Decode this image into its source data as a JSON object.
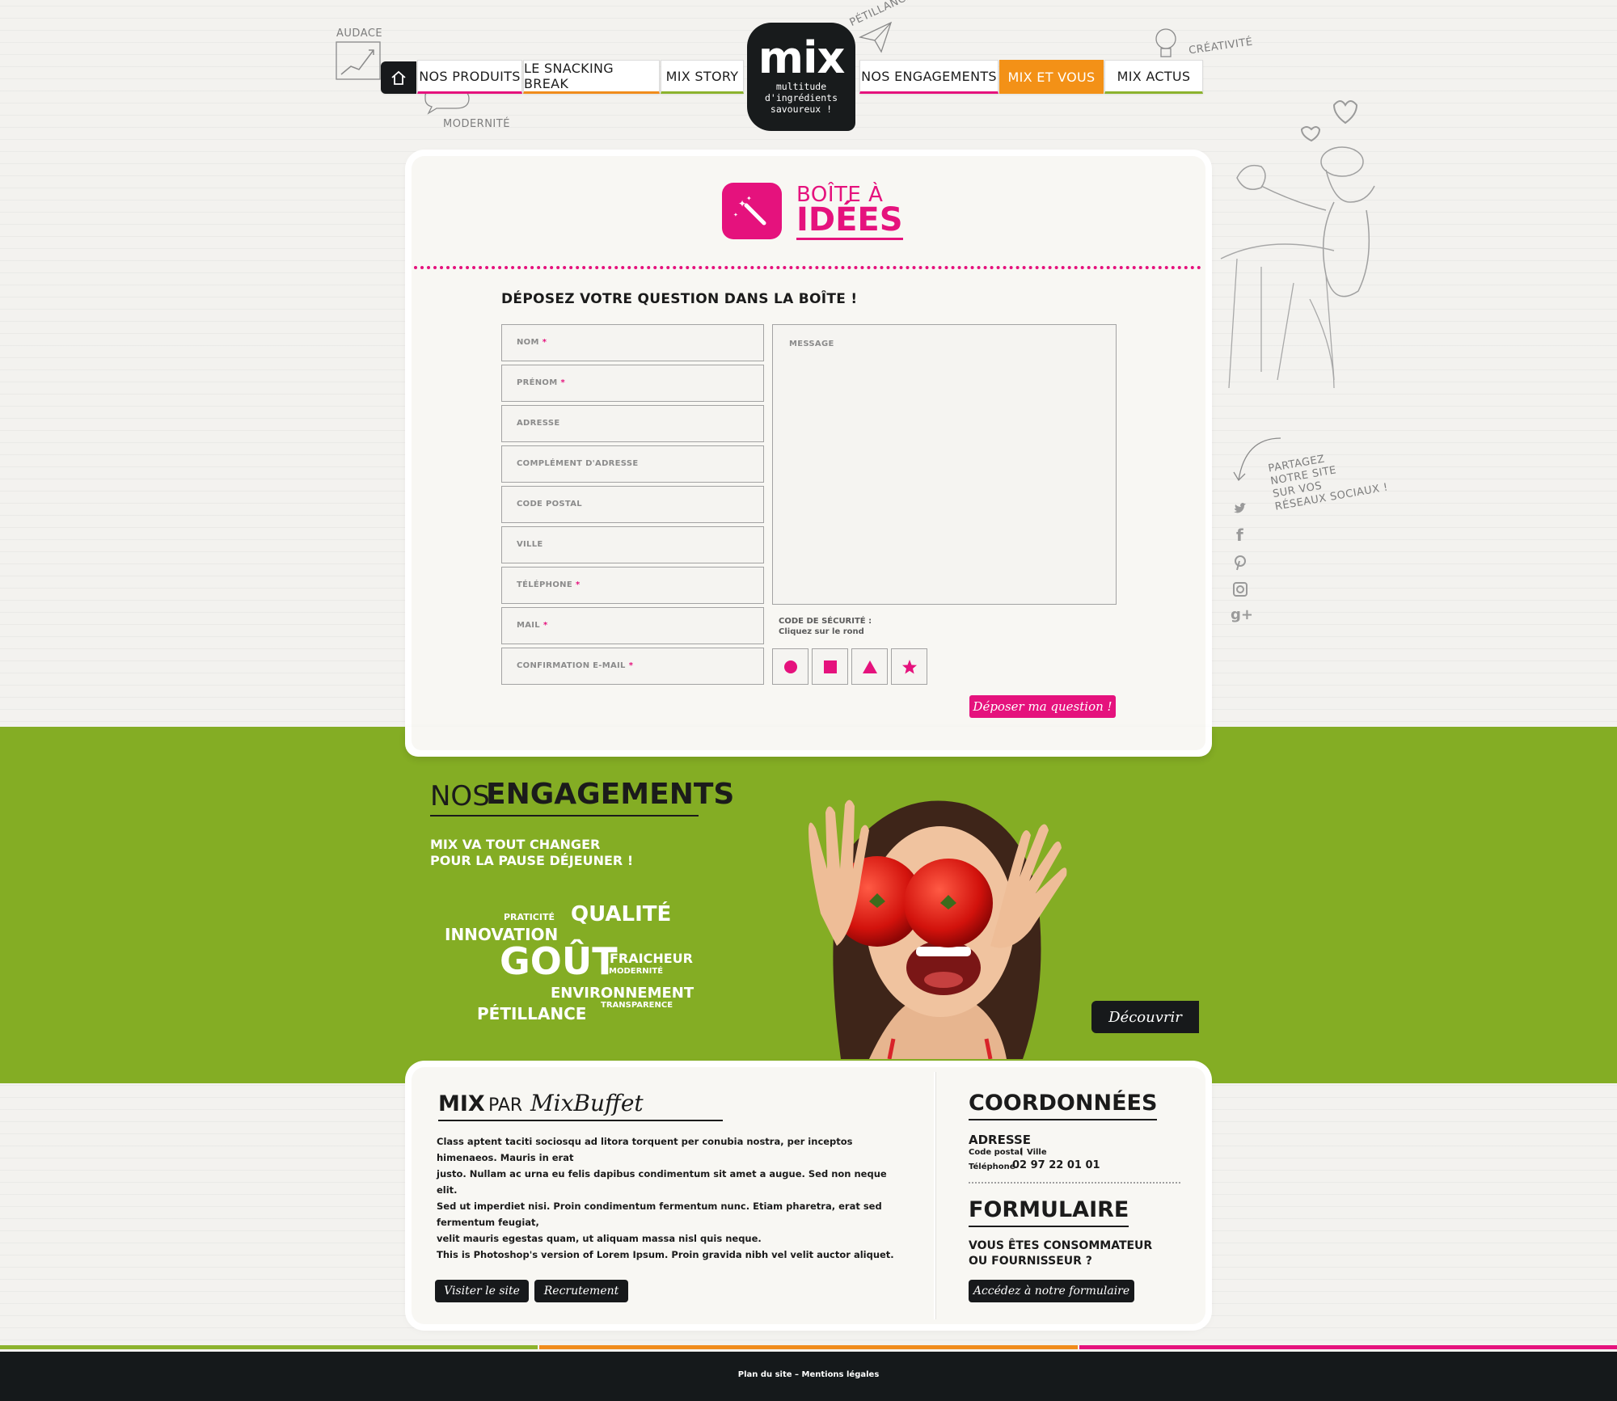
{
  "doodles": {
    "audace": "AUDACE",
    "modernite": "MODERNITÉ",
    "petillance": "PÉTILLANCE",
    "creativite": "CRÉATIVITÉ",
    "share_lines": [
      "PARTAGEZ",
      "NOTRE SITE",
      "SUR VOS",
      "RÉSEAUX SOCIAUX !"
    ]
  },
  "nav": {
    "home_icon": "home-icon",
    "items_left": [
      "NOS PRODUITS",
      "LE SNACKING BREAK",
      "MIX STORY"
    ],
    "items_right": [
      "NOS ENGAGEMENTS",
      "MIX ET VOUS",
      "MIX ACTUS"
    ],
    "active": "MIX ET VOUS"
  },
  "logo": {
    "text": "mix",
    "tagline": [
      "multitude",
      "d'ingrédients",
      "savoureux !"
    ]
  },
  "idea_box": {
    "title_line1": "BOÎTE À",
    "title_line2": "IDÉES",
    "icon": "magic-wand-icon",
    "form_heading": "DÉPOSEZ VOTRE QUESTION DANS LA BOÎTE !",
    "fields": [
      {
        "label": "NOM",
        "required": "*"
      },
      {
        "label": "PRÉNOM",
        "required": "*"
      },
      {
        "label": "ADRESSE",
        "required": ""
      },
      {
        "label": "COMPLÉMENT D'ADRESSE",
        "required": ""
      },
      {
        "label": "CODE POSTAL",
        "required": ""
      },
      {
        "label": "VILLE",
        "required": ""
      },
      {
        "label": "TÉLÉPHONE",
        "required": "*"
      },
      {
        "label": "MAIL",
        "required": "*"
      },
      {
        "label": "CONFIRMATION E-MAIL",
        "required": "*"
      }
    ],
    "message_placeholder": "MESSAGE",
    "security_label_1": "CODE DE SÉCURITÉ :",
    "security_label_2": "Cliquez sur le rond",
    "security_shapes": [
      "circle",
      "square",
      "triangle",
      "star"
    ],
    "submit": "Déposer ma question !"
  },
  "engagements": {
    "title_thin": "NOS",
    "title_bold": "ENGAGEMENTS",
    "subtitle_1": "MIX VA TOUT CHANGER",
    "subtitle_2": "POUR LA PAUSE DÉJEUNER !",
    "cloud": {
      "praticite": "PRATICITÉ",
      "qualite": "QUALITÉ",
      "innovation": "INNOVATION",
      "gout": "GOÛT",
      "fraicheur": "FRAICHEUR",
      "modernite": "MODERNITÉ",
      "environnement": "ENVIRONNEMENT",
      "transparence": "TRANSPARENCE",
      "petillance": "PÉTILLANCE"
    },
    "discover": "Découvrir"
  },
  "about": {
    "title_bold": "MIX",
    "title_thin": "PAR",
    "brand": "MixBuffet",
    "paragraph_lines": [
      "Class aptent taciti sociosqu ad litora torquent per conubia nostra, per inceptos himenaeos. Mauris in erat",
      "justo. Nullam ac urna eu felis dapibus condimentum sit amet a augue. Sed non neque elit.",
      "Sed ut imperdiet nisi. Proin condimentum fermentum nunc. Etiam pharetra, erat sed fermentum feugiat,",
      "velit mauris egestas quam, ut aliquam massa nisl quis neque.",
      "This is Photoshop's version  of Lorem Ipsum. Proin gravida nibh vel velit auctor aliquet."
    ],
    "btn_visit": "Visiter le site",
    "btn_jobs": "Recrutement"
  },
  "contact": {
    "title": "COORDONNÉES",
    "adresse_label": "ADRESSE",
    "code_postal": "Code postal",
    "ville": "Ville",
    "telephone_label": "Téléphone",
    "telephone": "02 97 22 01 01",
    "form_title": "FORMULAIRE",
    "form_question_1": "VOUS ÊTES CONSOMMATEUR",
    "form_question_2": "OU FOURNISSEUR ?",
    "form_button": "Accédez à notre formulaire"
  },
  "social": [
    "twitter-icon",
    "facebook-icon",
    "pinterest-icon",
    "instagram-icon",
    "google-plus-icon"
  ],
  "footer": {
    "text": "Plan du site – Mentions légales"
  },
  "colors": {
    "pink": "#e5127d",
    "orange": "#f39117",
    "green": "#84ad24",
    "dark": "#17191b"
  }
}
